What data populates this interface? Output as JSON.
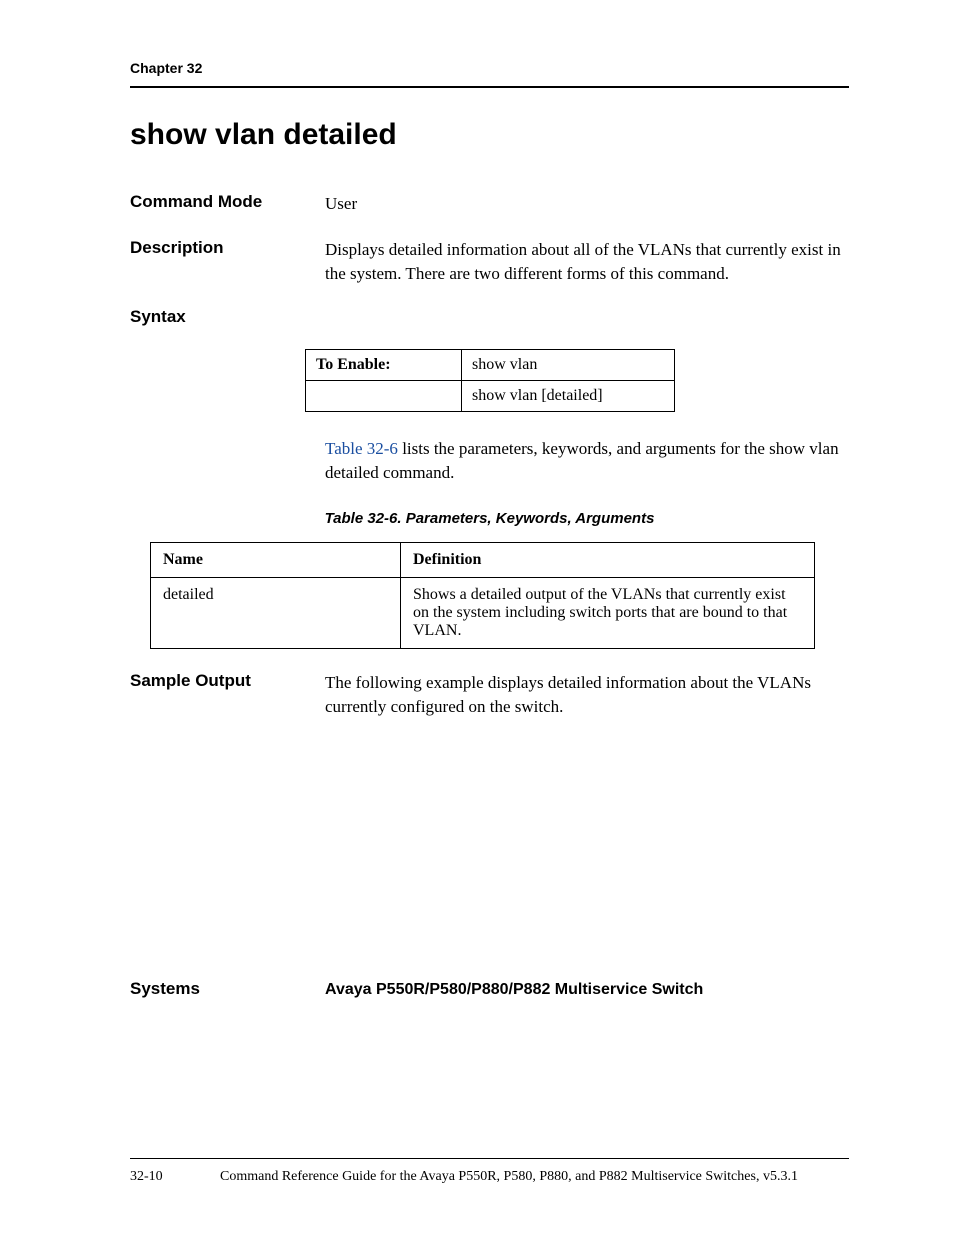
{
  "header": {
    "chapter": "Chapter 32"
  },
  "title": "show vlan detailed",
  "sections": {
    "command_mode": {
      "label": "Command Mode",
      "value": "User"
    },
    "description": {
      "label": "Description",
      "value": "Displays detailed information about all of the VLANs that currently exist in the system. There are two different forms of this command."
    },
    "syntax": {
      "label": "Syntax"
    },
    "sample_output": {
      "label": "Sample Output",
      "value": "The following example displays detailed information about the VLANs currently configured on the switch."
    },
    "systems": {
      "label": "Systems",
      "value": "Avaya P550R/P580/P880/P882 Multiservice Switch"
    }
  },
  "syntax_table": {
    "rows": [
      {
        "head": "To Enable:",
        "cmd": "show vlan"
      },
      {
        "head": "",
        "cmd": "show vlan [detailed]"
      }
    ]
  },
  "ref_sentence": {
    "link": "Table 32-6",
    "rest": " lists the parameters, keywords, and arguments for the show vlan detailed command."
  },
  "param_table": {
    "caption": "Table 32-6.  Parameters, Keywords, Arguments",
    "headers": {
      "name": "Name",
      "definition": "Definition"
    },
    "rows": [
      {
        "name": "detailed",
        "definition": "Shows a detailed output of the VLANs that currently exist on the system including switch ports that are bound to that VLAN."
      }
    ]
  },
  "footer": {
    "page": "32-10",
    "text": "Command Reference Guide for the Avaya P550R, P580, P880, and P882 Multiservice Switches, v5.3.1"
  }
}
